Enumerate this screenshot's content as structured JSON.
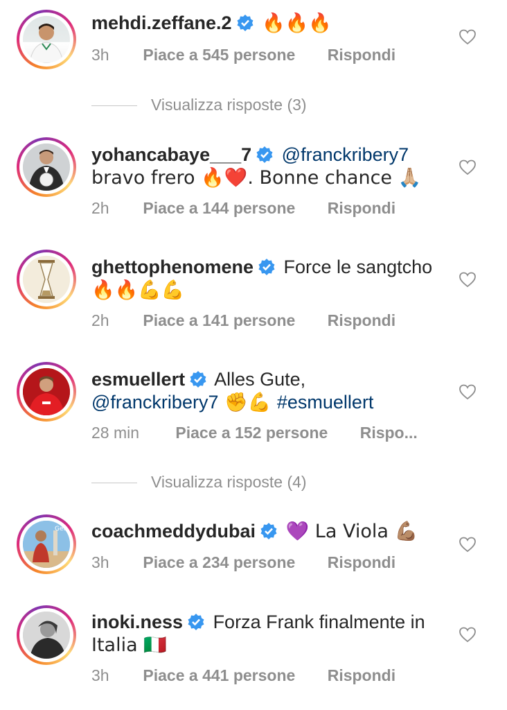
{
  "comments": [
    {
      "username": "mehdi.zeffane.2",
      "text": "🔥🔥🔥",
      "text2": "",
      "mention": "",
      "hashtag": "",
      "time": "3h",
      "likes": "Piace a 545 persone",
      "reply": "Rispondi"
    },
    {
      "username": "yohancabaye___7",
      "mention": "@franckribery7",
      "text": "bravo frero 🔥❤️. Bonne chance 🙏🏼",
      "time": "2h",
      "likes": "Piace a 144 persone",
      "reply": "Rispondi"
    },
    {
      "username": "ghettophenomene",
      "text": "Force le sangtcho",
      "text2": "🔥🔥💪💪",
      "time": "2h",
      "likes": "Piace a 141 persone",
      "reply": "Rispondi"
    },
    {
      "username": "esmuellert",
      "text": "Alles Gute,",
      "mention": "@franckribery7",
      "emoji": " ✊💪 ",
      "hashtag": "#esmuellert",
      "time": "28 min",
      "likes": "Piace a 152 persone",
      "reply": "Rispo..."
    },
    {
      "username": "coachmeddydubai",
      "text": "💜 La Viola 💪🏽",
      "time": "3h",
      "likes": "Piace a 234 persone",
      "reply": "Rispondi"
    },
    {
      "username": "inoki.ness",
      "text": "Forza Frank finalmente in",
      "text2": "Italia 🇮🇹",
      "time": "3h",
      "likes": "Piace a 441 persone",
      "reply": "Rispondi"
    }
  ],
  "view_replies": [
    "Visualizza risposte (3)",
    "Visualizza risposte (4)"
  ],
  "colors": {
    "text": "#262626",
    "meta": "#8e8e8e",
    "link": "#00376b",
    "verified": "#3897f0"
  }
}
